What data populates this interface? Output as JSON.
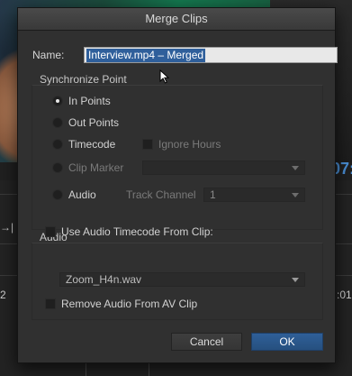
{
  "background": {
    "timecode_fragment": "07:",
    "track_label_left": "→|",
    "ruler_left": "2",
    "ruler_right": ":01"
  },
  "dialog": {
    "title": "Merge Clips",
    "name_label": "Name:",
    "name_value": "Interview.mp4 – Merged",
    "sync_group": {
      "title": "Synchronize Point",
      "options": {
        "in_points": "In Points",
        "out_points": "Out Points",
        "timecode": "Timecode",
        "clip_marker": "Clip Marker",
        "audio": "Audio"
      },
      "selected": "In Points",
      "ignore_hours": "Ignore Hours",
      "track_channel_label": "Track Channel",
      "track_channel_value": "1"
    },
    "audio_group": {
      "title": "Audio",
      "use_audio_timecode": "Use Audio Timecode From Clip:",
      "clip_value": "Zoom_H4n.wav",
      "remove_audio": "Remove Audio From AV Clip"
    },
    "buttons": {
      "cancel": "Cancel",
      "ok": "OK"
    }
  },
  "colors": {
    "accent": "#2f5f9b",
    "dialog_bg": "#303030",
    "timecode_blue": "#4a8fd6"
  },
  "icons": [
    "mouse-pointer-icon",
    "radio-selected-icon",
    "dropdown-arrow-icon"
  ]
}
